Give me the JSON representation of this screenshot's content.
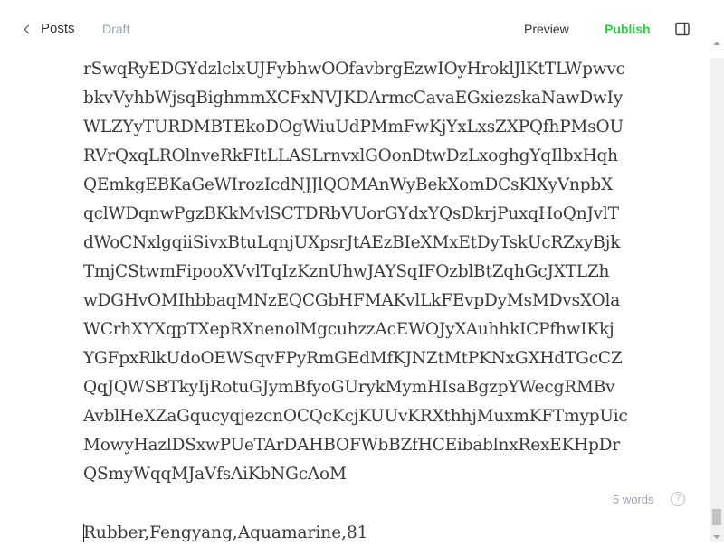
{
  "header": {
    "back_label": "Posts",
    "status_label": "Draft",
    "preview_label": "Preview",
    "publish_label": "Publish",
    "publish_color": "#30cf43",
    "sidebar_icon": "sidebar-toggle-icon"
  },
  "editor": {
    "lines": [
      "rSwqRyEDGYdzlclxUJFybhwOOfavbrgEzwIOyHroklJlKtTLWpwvc",
      "bkvVyhbWjsqBighmmXCFxNVJKDArmcCavaEGxiezskaNawDwIy",
      "WLZYyTURDMBTEkoDOgWiuUdPMmFwKjYxLxsZXPQfhPMsOU",
      "RVrQxqLROlnveRkFItLLASLrnvxlGOonDtwDzLxoghgYqIlbxHqh",
      "QEmkgEBKaGeWIrozIcdNJJlQOMAnWyBekXomDCsKlXyVnpbX",
      "qclWDqnwPgzBKkMvlSCTDRbVUorGYdxYQsDkrjPuxqHoQnJvlT",
      "dWoCNxlgqiiSivxBtuLqnjUXpsrJtAEzBIeXMxEtDyTskUcRZxyBjk",
      "TmjCStwmFipooXVvlTqIzKznUhwJAYSqIFOzblBtZqhGcJXTLZh",
      "wDGHvOMIhbbaqMNzEQCGbHFMAKvlLkFEvpDyMsMDvsXOla",
      "WCrhXYXqpTXepRXnenolMgcuhzzAcEWOJyXAuhhkICPfhwIKkj",
      "YGFpxRlkUdoOEWSqvFPyRmGEdMfKJNZtMtPKNxGXHdTGcCZ",
      "QqJQWSBTkyIjRotuGJymBfyoGUrykMymHIsaBgzpYWecgRMBv",
      "AvblHeXZaGqucyqjezcnOCQcKcjKUUvKRXthhjMuxmKFTmypUic",
      "MowyHazlDSxwPUeTArDAHBOFWbBZfHCEibablnxRexEKHpDr",
      "QSmyWqqMJaVfsAiKbNGcAoM"
    ],
    "word_count": "5 words",
    "help_icon": "?",
    "current_line": "Rubber,Fengyang,Aquamarine,81"
  }
}
